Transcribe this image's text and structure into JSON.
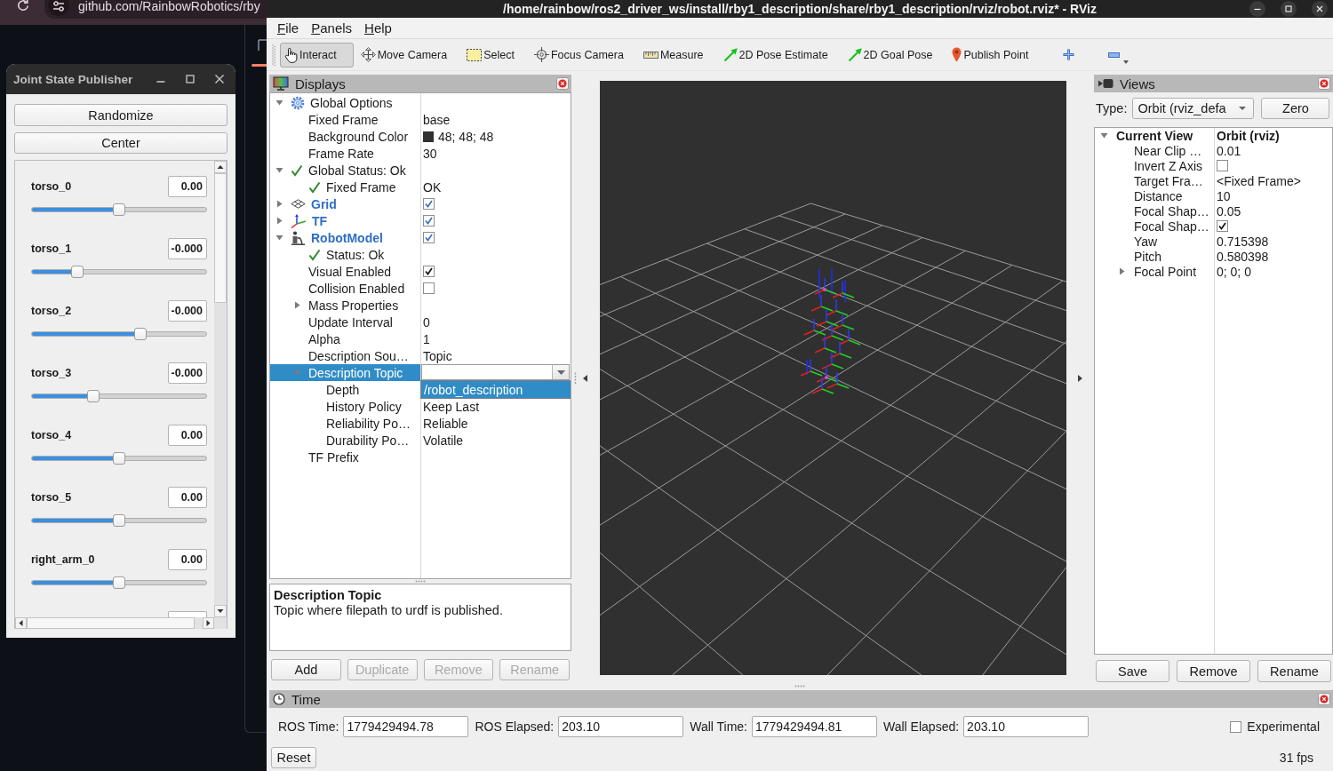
{
  "browser": {
    "address": "github.com/RainbowRobotics/rby"
  },
  "joint_state_publisher": {
    "title": "Joint State Publisher",
    "buttons": [
      "Randomize",
      "Center"
    ],
    "joints": [
      {
        "name": "torso_0",
        "value": "0.00",
        "level": 0.5
      },
      {
        "name": "torso_1",
        "value": "-0.000",
        "level": 0.26
      },
      {
        "name": "torso_2",
        "value": "-0.000",
        "level": 0.62
      },
      {
        "name": "torso_3",
        "value": "-0.000",
        "level": 0.35
      },
      {
        "name": "torso_4",
        "value": "0.00",
        "level": 0.5
      },
      {
        "name": "torso_5",
        "value": "0.00",
        "level": 0.5
      },
      {
        "name": "right_arm_0",
        "value": "0.00",
        "level": 0.5
      }
    ]
  },
  "rviz": {
    "window": {
      "title": "/home/rainbow/ros2_driver_ws/install/rby1_description/share/rby1_description/rviz/robot.rviz* - RViz"
    },
    "menu": [
      "File",
      "Panels",
      "Help"
    ],
    "tools": [
      {
        "label": "Interact",
        "kind": "interact",
        "selected": true
      },
      {
        "label": "Move Camera",
        "kind": "move_camera",
        "selected": false
      },
      {
        "label": "Select",
        "kind": "select",
        "selected": false
      },
      {
        "label": "Focus Camera",
        "kind": "focus_camera",
        "selected": false
      },
      {
        "label": "Measure",
        "kind": "measure",
        "selected": false
      },
      {
        "label": "2D Pose Estimate",
        "kind": "pose_estimate",
        "selected": false
      },
      {
        "label": "2D Goal Pose",
        "kind": "goal_pose",
        "selected": false
      },
      {
        "label": "Publish Point",
        "kind": "publish_point",
        "selected": false
      },
      {
        "kind": "add_tool"
      },
      {
        "kind": "remove_tool"
      }
    ],
    "displays": {
      "title": "Displays",
      "tree": [
        {
          "label": "Global Options",
          "kind": "options",
          "expanded": true,
          "selected": false,
          "children": [
            {
              "label": "Fixed Frame",
              "kind": "property",
              "value": "base",
              "selected": false
            },
            {
              "label": "Background Color",
              "kind": "property",
              "value": "48; 48; 48",
              "color": "#303030",
              "selected": false
            },
            {
              "label": "Frame Rate",
              "kind": "property",
              "value": "30",
              "selected": false
            }
          ]
        },
        {
          "label": "Global Status: Ok",
          "kind": "status",
          "expanded": true,
          "selected": false,
          "children": [
            {
              "label": "Fixed Frame",
              "kind": "status",
              "value": "OK",
              "selected": false
            }
          ]
        },
        {
          "label": "Grid",
          "kind": "grid",
          "expanded": false,
          "checked": true,
          "selected": false
        },
        {
          "label": "TF",
          "kind": "tf",
          "expanded": false,
          "checked": true,
          "selected": false
        },
        {
          "label": "RobotModel",
          "kind": "robot_model",
          "expanded": true,
          "checked": true,
          "selected": false,
          "children": [
            {
              "label": "Status: Ok",
              "kind": "status",
              "selected": false
            },
            {
              "label": "Visual Enabled",
              "kind": "property",
              "checked": true,
              "selected": false
            },
            {
              "label": "Collision Enabled",
              "kind": "property",
              "checked": false,
              "selected": false
            },
            {
              "label": "Mass Properties",
              "kind": "property",
              "expanded": false,
              "selected": false
            },
            {
              "label": "Update Interval",
              "kind": "property",
              "value": "0",
              "selected": false
            },
            {
              "label": "Alpha",
              "kind": "property",
              "value": "1",
              "selected": false
            },
            {
              "label": "Description Sou…",
              "kind": "property",
              "value": "Topic",
              "selected": false
            },
            {
              "label": "Description Topic",
              "kind": "property",
              "expanded": true,
              "selected": true,
              "editor": {
                "kind": "combobox",
                "open": true,
                "options": [
                  {
                    "label": "/robot_description",
                    "selected": true
                  }
                ]
              },
              "children": [
                {
                  "label": "Depth",
                  "kind": "property",
                  "selected": false
                },
                {
                  "label": "History Policy",
                  "kind": "property",
                  "value": "Keep Last",
                  "selected": false
                },
                {
                  "label": "Reliability Po…",
                  "kind": "property",
                  "value": "Reliable",
                  "selected": false
                },
                {
                  "label": "Durability Po…",
                  "kind": "property",
                  "value": "Volatile",
                  "selected": false
                }
              ]
            },
            {
              "label": "TF Prefix",
              "kind": "property",
              "selected": false
            }
          ]
        }
      ],
      "description": {
        "title": "Description Topic",
        "text": "Topic where filepath to urdf is published."
      },
      "buttons": [
        {
          "label": "Add",
          "disabled": false
        },
        {
          "label": "Duplicate",
          "disabled": true
        },
        {
          "label": "Remove",
          "disabled": true
        },
        {
          "label": "Rename",
          "disabled": true
        }
      ]
    },
    "views": {
      "title": "Views",
      "type_label": "Type:",
      "type_value": "Orbit (rviz_defa",
      "zero_button": "Zero",
      "tree": [
        {
          "label": "Current View",
          "kind": "category",
          "value": "Orbit (rviz)",
          "expanded": true,
          "children": [
            {
              "label": "Near Clip …",
              "kind": "property",
              "value": "0.01"
            },
            {
              "label": "Invert Z Axis",
              "kind": "property",
              "checked": false
            },
            {
              "label": "Target Fra…",
              "kind": "property",
              "value": "<Fixed Frame>"
            },
            {
              "label": "Distance",
              "kind": "property",
              "value": "10"
            },
            {
              "label": "Focal Shap…",
              "kind": "property",
              "value": "0.05"
            },
            {
              "label": "Focal Shap…",
              "kind": "property",
              "checked": true
            },
            {
              "label": "Yaw",
              "kind": "property",
              "value": "0.715398"
            },
            {
              "label": "Pitch",
              "kind": "property",
              "value": "0.580398"
            },
            {
              "label": "Focal Point",
              "kind": "property",
              "value": "0; 0; 0",
              "expanded": false
            }
          ]
        }
      ],
      "buttons": [
        "Save",
        "Remove",
        "Rename"
      ]
    },
    "time": {
      "title": "Time",
      "fields": [
        {
          "label": "ROS Time:",
          "value": "1779429494.78"
        },
        {
          "label": "ROS Elapsed:",
          "value": "203.10"
        },
        {
          "label": "Wall Time:",
          "value": "1779429494.81"
        },
        {
          "label": "Wall Elapsed:",
          "value": "203.10"
        }
      ],
      "experimental": {
        "label": "Experimental",
        "checked": false
      },
      "reset_button": "Reset",
      "fps": "31 fps"
    }
  }
}
